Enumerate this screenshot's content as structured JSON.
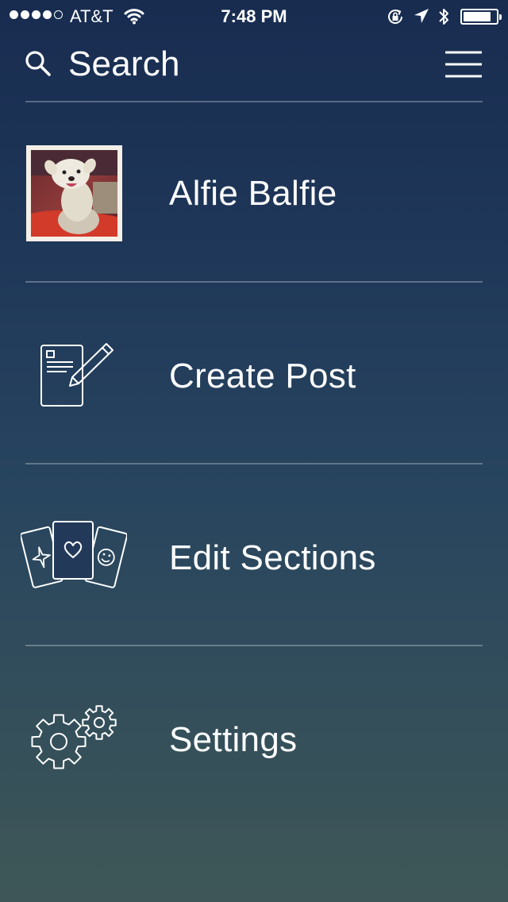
{
  "status_bar": {
    "carrier": "AT&T",
    "time": "7:48 PM",
    "signal_bars_filled": 4,
    "signal_bars_total": 5,
    "battery_level": 0.85
  },
  "header": {
    "search_label": "Search",
    "search_icon": "search-icon",
    "menu_icon": "hamburger-menu-icon"
  },
  "menu": {
    "profile": {
      "label": "Alfie Balfie",
      "icon": "avatar"
    },
    "create_post": {
      "label": "Create Post",
      "icon": "compose-icon"
    },
    "edit_sections": {
      "label": "Edit Sections",
      "icon": "cards-icon"
    },
    "settings": {
      "label": "Settings",
      "icon": "gears-icon"
    }
  },
  "colors": {
    "background_top": "#182c50",
    "background_bottom": "#3b5556",
    "text": "#ffffff",
    "divider": "rgba(255,255,255,0.28)"
  }
}
